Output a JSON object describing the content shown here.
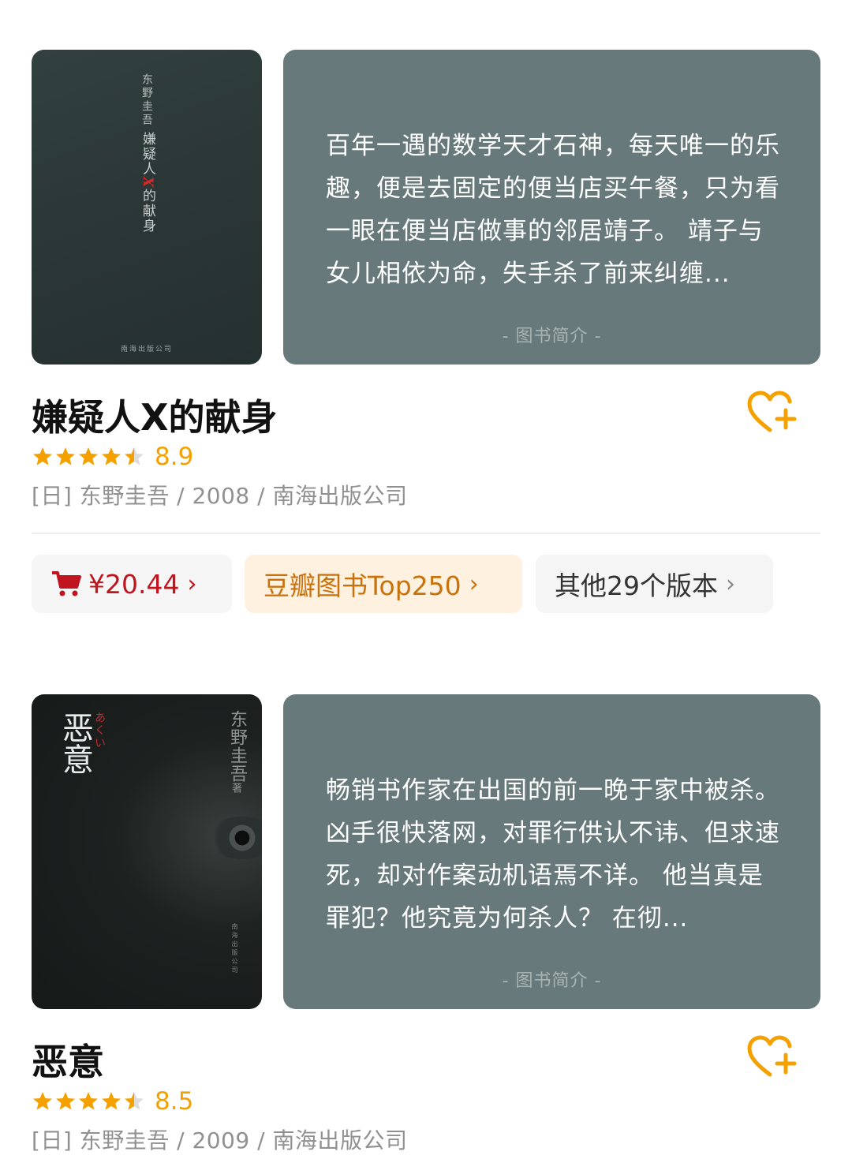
{
  "colors": {
    "accent_orange": "#F4A100",
    "price_red": "#C0141E",
    "intro_bg": "#67797A",
    "top250_bg": "#FFF1E0"
  },
  "books": [
    {
      "cover": {
        "author": "东野圭吾",
        "title_a": "嫌疑人",
        "title_x": "X",
        "title_b": "的献身",
        "publisher": "南海出版公司"
      },
      "intro": "百年一遇的数学天才石神，每天唯一的乐趣，便是去固定的便当店买午餐，只为看一眼在便当店做事的邻居靖子。 靖子与女儿相依为命，失手杀了前来纠缠...",
      "intro_label": "-  图书简介  -",
      "title": "嫌疑人X的献身",
      "rating": 8.9,
      "rating_text": "8.9",
      "stars": 4.5,
      "meta": "[日] 东野圭吾 / 2008 / 南海出版公司",
      "price": "¥20.44",
      "top250": "豆瓣图书Top250",
      "editions": "其他29个版本",
      "wishlist_icon": "heart-plus-icon"
    },
    {
      "cover": {
        "title": "恶意",
        "kana": "あくい",
        "author": "东野圭吾",
        "author_suffix": "著",
        "publisher": "南海出版公司"
      },
      "intro": "畅销书作家在出国的前一晚于家中被杀。凶手很快落网，对罪行供认不讳、但求速死，却对作案动机语焉不详。 他当真是罪犯？他究竟为何杀人？ 在彻...",
      "intro_label": "-  图书简介  -",
      "title": "恶意",
      "rating": 8.5,
      "rating_text": "8.5",
      "stars": 4.5,
      "meta": "[日] 东野圭吾 / 2009 / 南海出版公司",
      "wishlist_icon": "heart-plus-icon"
    }
  ]
}
